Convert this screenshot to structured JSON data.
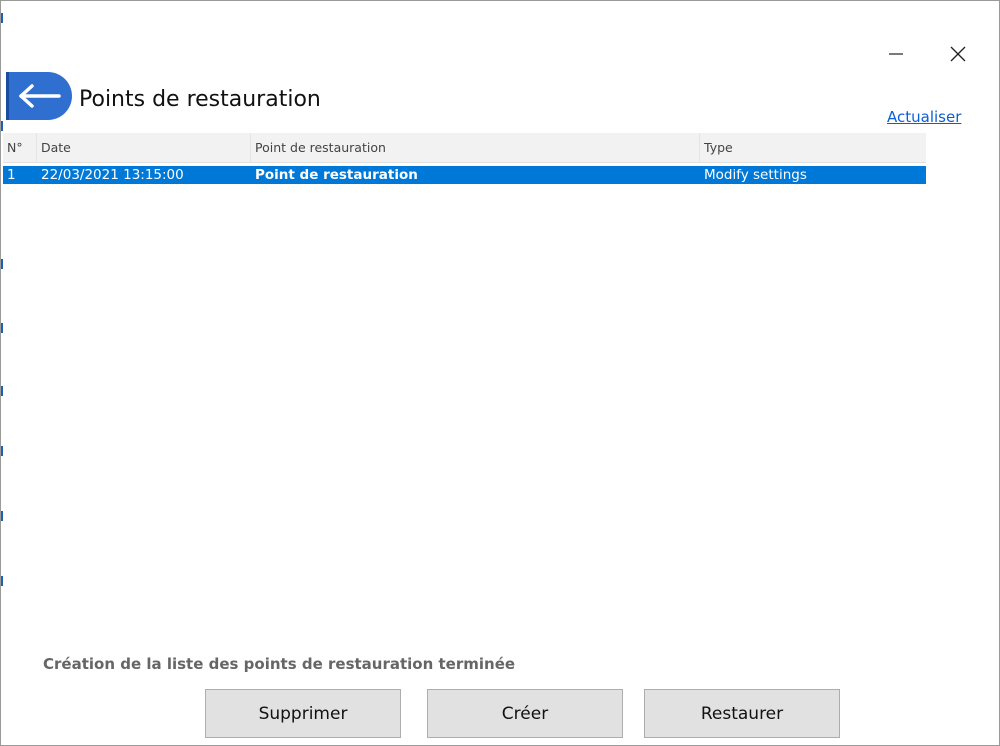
{
  "window": {
    "minimize_glyph": "—",
    "close_glyph": "✕"
  },
  "header": {
    "title": "Points de restauration",
    "back_icon": "arrow-left-icon",
    "refresh_link": "Actualiser"
  },
  "table": {
    "columns": [
      "N°",
      "Date",
      "Point de restauration",
      "Type"
    ],
    "rows": [
      {
        "num": "1",
        "date": "22/03/2021 13:15:00",
        "name": "Point de restauration",
        "type": "Modify settings",
        "selected": true
      }
    ]
  },
  "status_text": "Création de la liste des points de restauration terminée",
  "buttons": {
    "delete": "Supprimer",
    "create": "Créer",
    "restore": "Restaurer"
  },
  "colors": {
    "accent": "#2f6fd0",
    "selection": "#0078d7",
    "link": "#0b5fd6"
  }
}
